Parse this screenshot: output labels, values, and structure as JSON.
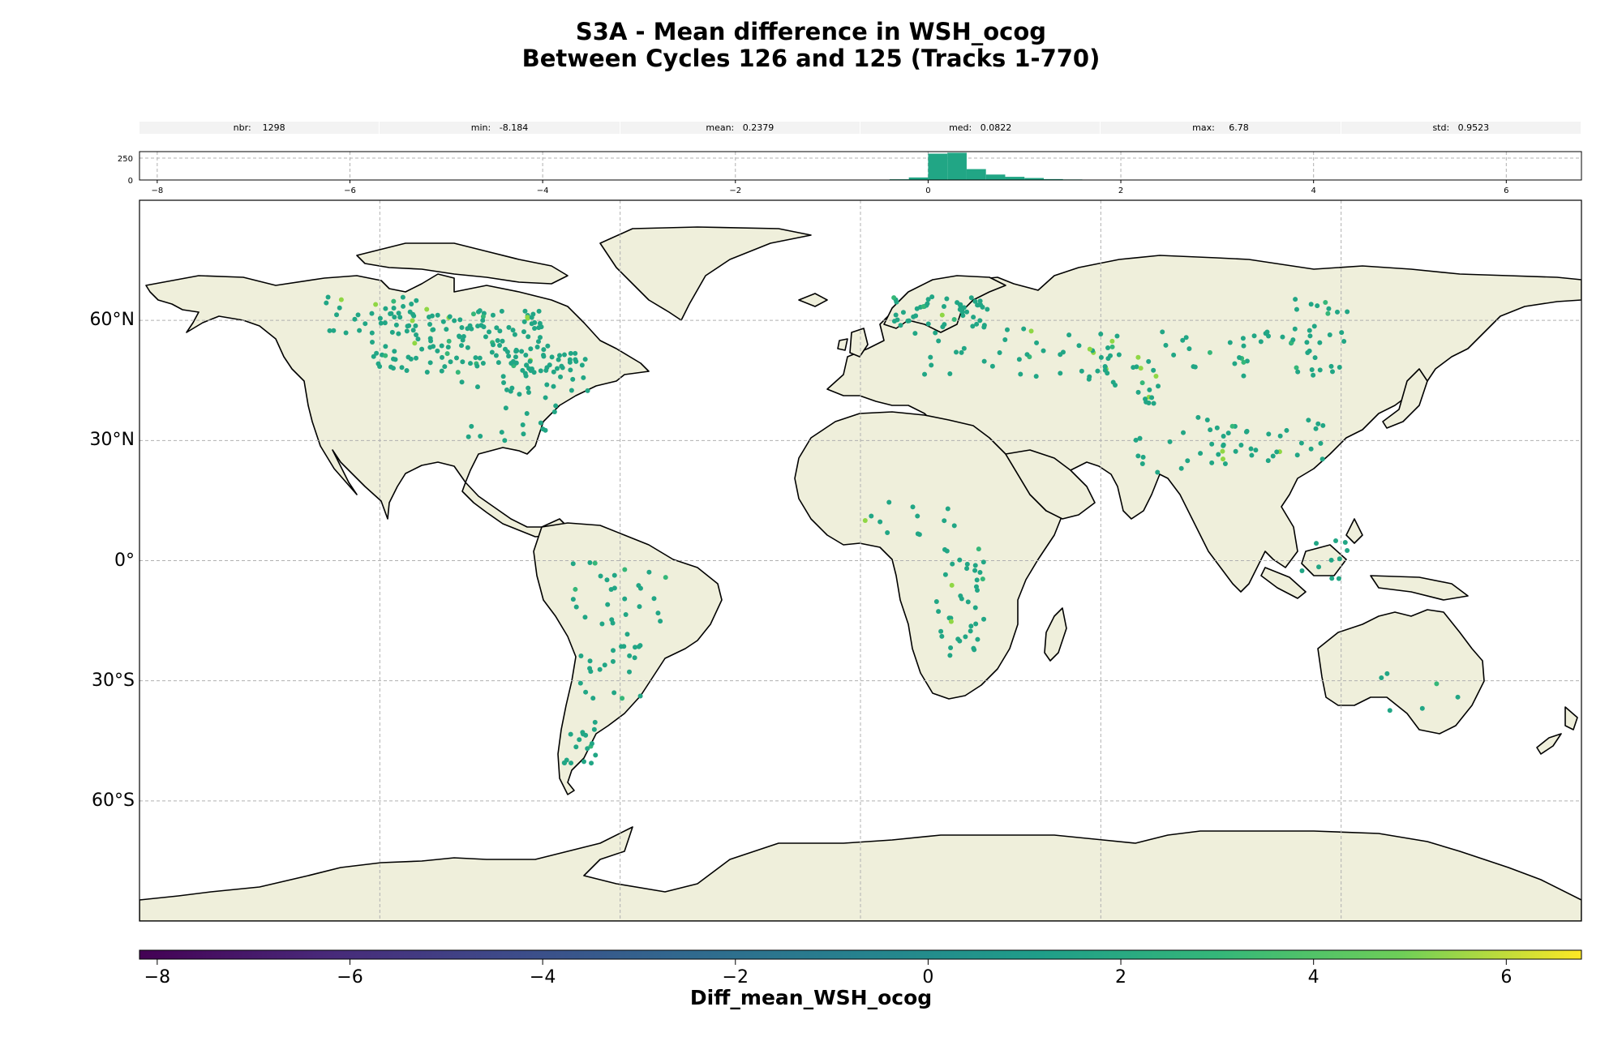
{
  "title_line1": "S3A - Mean difference in WSH_ocog",
  "title_line2": "Between Cycles 126 and 125 (Tracks 1-770)",
  "stats": [
    {
      "label": "nbr:",
      "value": "1298"
    },
    {
      "label": "min:",
      "value": "-8.184"
    },
    {
      "label": "mean:",
      "value": "0.2379"
    },
    {
      "label": "med:",
      "value": "0.0822"
    },
    {
      "label": "max:",
      "value": "6.78"
    },
    {
      "label": "std:",
      "value": "0.9523"
    }
  ],
  "histogram": {
    "x_ticks": [
      "−8",
      "−6",
      "−4",
      "−2",
      "0",
      "2",
      "4",
      "6"
    ],
    "y_ticks": [
      "0",
      "250"
    ],
    "bar_color": "#21a685"
  },
  "map": {
    "lat_labels": [
      "60°N",
      "30°N",
      "0°",
      "30°S",
      "60°S"
    ],
    "land_color": "#efefdb",
    "coast_color": "#000000",
    "grid_color": "#b0b0b0"
  },
  "colorbar": {
    "label": "Diff_mean_WSH_ocog",
    "ticks": [
      "−8",
      "−6",
      "−4",
      "−2",
      "0",
      "2",
      "4",
      "6"
    ],
    "colormap": "viridis",
    "range": [
      -8.184,
      6.78
    ]
  },
  "points_color": "#21a685"
}
